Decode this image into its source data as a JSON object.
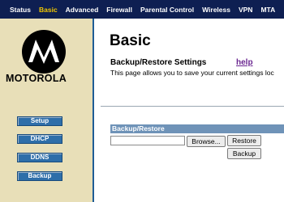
{
  "topnav": {
    "tabs": [
      "Status",
      "Basic",
      "Advanced",
      "Firewall",
      "Parental Control",
      "Wireless",
      "VPN",
      "MTA"
    ],
    "active": "Basic",
    "bg_color": "#0e1f52",
    "active_color": "#f2c800"
  },
  "sidebar": {
    "brand": "MOTOROLA",
    "logo_icon": "motorola-logo-icon",
    "items": [
      {
        "label": "Setup"
      },
      {
        "label": "DHCP"
      },
      {
        "label": "DDNS"
      },
      {
        "label": "Backup"
      }
    ]
  },
  "main": {
    "title": "Basic",
    "section_title": "Backup/Restore Settings",
    "help_label": "help",
    "description": "This page allows you to save your current settings loc",
    "panel": {
      "header": "Backup/Restore",
      "file_value": "",
      "browse_label": "Browse...",
      "restore_label": "Restore",
      "backup_label": "Backup"
    }
  }
}
